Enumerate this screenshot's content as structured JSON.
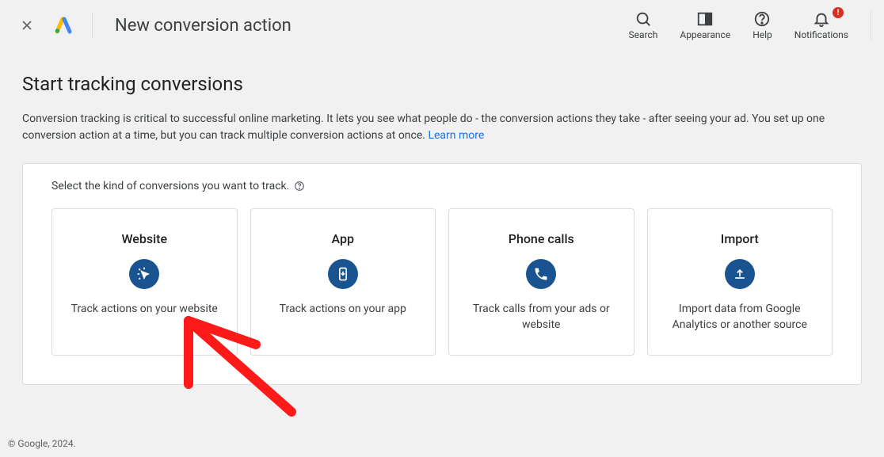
{
  "header": {
    "title": "New conversion action",
    "search_label": "Search",
    "appearance_label": "Appearance",
    "help_label": "Help",
    "notifications_label": "Notifications"
  },
  "page": {
    "heading": "Start tracking conversions",
    "description_1": "Conversion tracking is critical to successful online marketing. It lets you see what people do - the conversion actions they take - after seeing your ad. You set up one conversion action at a time, but you can track multiple conversion actions at once.  ",
    "learn_more": "Learn more",
    "select_prompt": "Select the kind of conversions you want to track."
  },
  "options": [
    {
      "title": "Website",
      "desc": "Track actions on your website"
    },
    {
      "title": "App",
      "desc": "Track actions on your app"
    },
    {
      "title": "Phone calls",
      "desc": "Track calls from your ads or website"
    },
    {
      "title": "Import",
      "desc": "Import data from Google Analytics or another source"
    }
  ],
  "footer": {
    "copyright": "© Google, 2024."
  }
}
